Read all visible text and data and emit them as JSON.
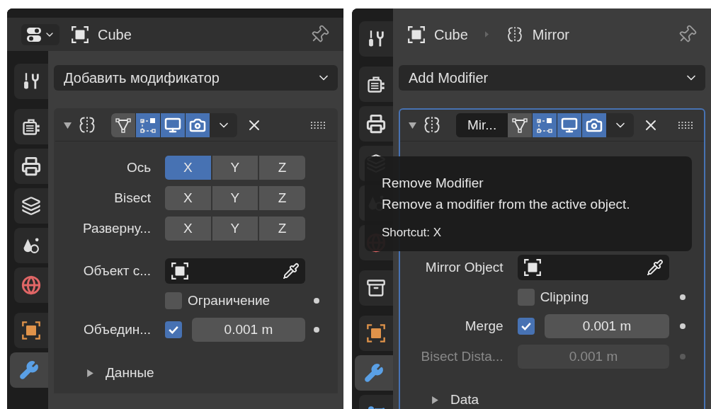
{
  "panels": [
    {
      "header": {
        "editor_menu": true,
        "breadcrumb": [
          {
            "kind": "object",
            "label": "Cube"
          }
        ]
      },
      "sidebar_groups": [
        [
          {
            "kind": "tool",
            "selected": false
          }
        ],
        [
          {
            "kind": "render",
            "selected": false
          },
          {
            "kind": "output",
            "selected": false
          },
          {
            "kind": "view_layer",
            "selected": false
          },
          {
            "kind": "scene",
            "selected": false
          },
          {
            "kind": "world",
            "selected": false
          }
        ],
        [
          {
            "kind": "object",
            "selected": false
          },
          {
            "kind": "modifier",
            "selected": true
          }
        ]
      ],
      "add_modifier": {
        "label": "Добавить модификатор"
      },
      "modifier": {
        "active": false,
        "expanded": true,
        "toggles": [
          {
            "kind": "edit_mode",
            "on": false
          },
          {
            "kind": "cage",
            "on": true
          },
          {
            "kind": "viewport",
            "on": true
          },
          {
            "kind": "render",
            "on": true
          }
        ],
        "rows": [
          {
            "kind": "axis",
            "label": "Ось",
            "buttons": [
              {
                "label": "X",
                "selected": true
              },
              {
                "label": "Y",
                "selected": false
              },
              {
                "label": "Z",
                "selected": false
              }
            ]
          },
          {
            "kind": "axis",
            "label": "Bisect",
            "buttons": [
              {
                "label": "X",
                "selected": false
              },
              {
                "label": "Y",
                "selected": false
              },
              {
                "label": "Z",
                "selected": false
              }
            ]
          },
          {
            "kind": "axis",
            "label": "Разверну...",
            "buttons": [
              {
                "label": "X",
                "selected": false
              },
              {
                "label": "Y",
                "selected": false
              },
              {
                "label": "Z",
                "selected": false
              }
            ]
          },
          {
            "kind": "object_field",
            "label": "Объект с..."
          },
          {
            "kind": "checkbox",
            "label": "Ограничение",
            "checked": false,
            "keyframe_dot": true
          },
          {
            "kind": "checkbox_value",
            "label": "Объедин...",
            "checked": true,
            "value": "0.001 m",
            "keyframe_dot": true
          }
        ],
        "subpanel": {
          "label": "Данные",
          "expanded": false
        }
      }
    },
    {
      "header": {
        "editor_menu": false,
        "breadcrumb": [
          {
            "kind": "object",
            "label": "Cube"
          },
          {
            "kind": "modifier",
            "label": "Mirror"
          }
        ]
      },
      "sidebar_groups": [
        [
          {
            "kind": "tool",
            "selected": false
          }
        ],
        [
          {
            "kind": "render",
            "selected": false
          },
          {
            "kind": "output",
            "selected": false
          },
          {
            "kind": "view_layer",
            "selected": false
          },
          {
            "kind": "scene",
            "selected": false
          },
          {
            "kind": "world",
            "selected": false
          }
        ],
        [
          {
            "kind": "collection",
            "selected": false
          }
        ],
        [
          {
            "kind": "object",
            "selected": false
          },
          {
            "kind": "modifier",
            "selected": true
          },
          {
            "kind": "particles",
            "selected": false
          }
        ]
      ],
      "add_modifier": {
        "label": "Add Modifier"
      },
      "modifier": {
        "active": true,
        "expanded": true,
        "name": "Mir...",
        "toggles": [
          {
            "kind": "edit_mode",
            "on": false
          },
          {
            "kind": "cage",
            "on": true
          },
          {
            "kind": "viewport",
            "on": true
          },
          {
            "kind": "render",
            "on": true
          }
        ],
        "rows": [
          {
            "kind": "object_field",
            "label": "Mirror Object"
          },
          {
            "kind": "checkbox",
            "label": "Clipping",
            "checked": false,
            "keyframe_dot": true
          },
          {
            "kind": "checkbox_value",
            "label": "Merge",
            "checked": true,
            "value": "0.001 m",
            "keyframe_dot": true
          },
          {
            "kind": "value",
            "label": "Bisect Dista...",
            "value": "0.001 m",
            "disabled": true,
            "keyframe_dot": true
          }
        ],
        "subpanel": {
          "label": "Data",
          "expanded": false
        }
      },
      "tooltip": {
        "title": "Remove Modifier",
        "description": "Remove a modifier from the active object.",
        "shortcut": "Shortcut: X"
      }
    }
  ]
}
